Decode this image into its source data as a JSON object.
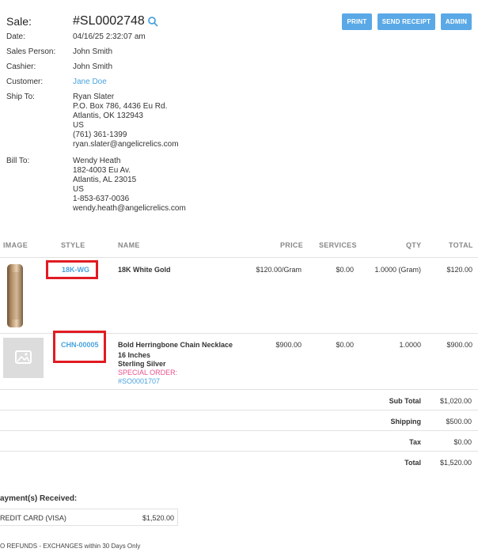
{
  "header": {
    "sale_label": "Sale:",
    "sale_number": "#SL0002748",
    "search_icon": "search-icon",
    "buttons": {
      "print": "PRINT",
      "send_receipt": "SEND RECEIPT",
      "admin": "ADMIN"
    },
    "accent": "#5aa9e6"
  },
  "details": {
    "date_label": "Date:",
    "date": "04/16/25 2:32:07 am",
    "salesperson_label": "Sales Person:",
    "salesperson": "John Smith",
    "cashier_label": "Cashier:",
    "cashier": "John Smith",
    "customer_label": "Customer:",
    "customer": "Jane Doe",
    "ship_label": "Ship To:",
    "ship_to": [
      "Ryan Slater",
      "P.O. Box 786, 4436 Eu Rd.",
      "Atlantis, OK 132943",
      "US",
      "(761) 361-1399",
      "ryan.slater@angelicrelics.com"
    ],
    "bill_label": "Bill To:",
    "bill_to": [
      "Wendy Heath",
      "182-4003 Eu Av.",
      "Atlantis, AL 23015",
      "US",
      "1-853-637-0036",
      "wendy.heath@angelicrelics.com"
    ]
  },
  "table": {
    "columns": {
      "image": "IMAGE",
      "style": "STYLE",
      "name": "NAME",
      "price": "PRICE",
      "services": "SERVICES",
      "qty": "QTY",
      "total": "TOTAL"
    },
    "rows": [
      {
        "style": "18K-WG",
        "name": "18K White Gold",
        "sub1": "",
        "sub2": "",
        "special": "",
        "special_link": "",
        "price": "$120.00/Gram",
        "services": "$0.00",
        "qty": "1.0000 (Gram)",
        "total": "$120.00"
      },
      {
        "style": "CHN-00005",
        "name": "Bold Herringbone Chain Necklace",
        "sub1": "16 Inches",
        "sub2": "Sterling Silver",
        "special": "SPECIAL ORDER:",
        "special_link": "#SO0001707",
        "price": "$900.00",
        "services": "$0.00",
        "qty": "1.0000",
        "total": "$900.00"
      }
    ]
  },
  "totals": {
    "subtotal_label": "Sub Total",
    "subtotal": "$1,020.00",
    "shipping_label": "Shipping",
    "shipping": "$500.00",
    "tax_label": "Tax",
    "tax": "$0.00",
    "total_label": "Total",
    "total": "$1,520.00"
  },
  "payments": {
    "heading": "ayment(s) Received:",
    "method": "REDIT CARD (VISA)",
    "amount": "$1,520.00"
  },
  "footer_note": "O REFUNDS - EXCHANGES within 30 Days Only"
}
